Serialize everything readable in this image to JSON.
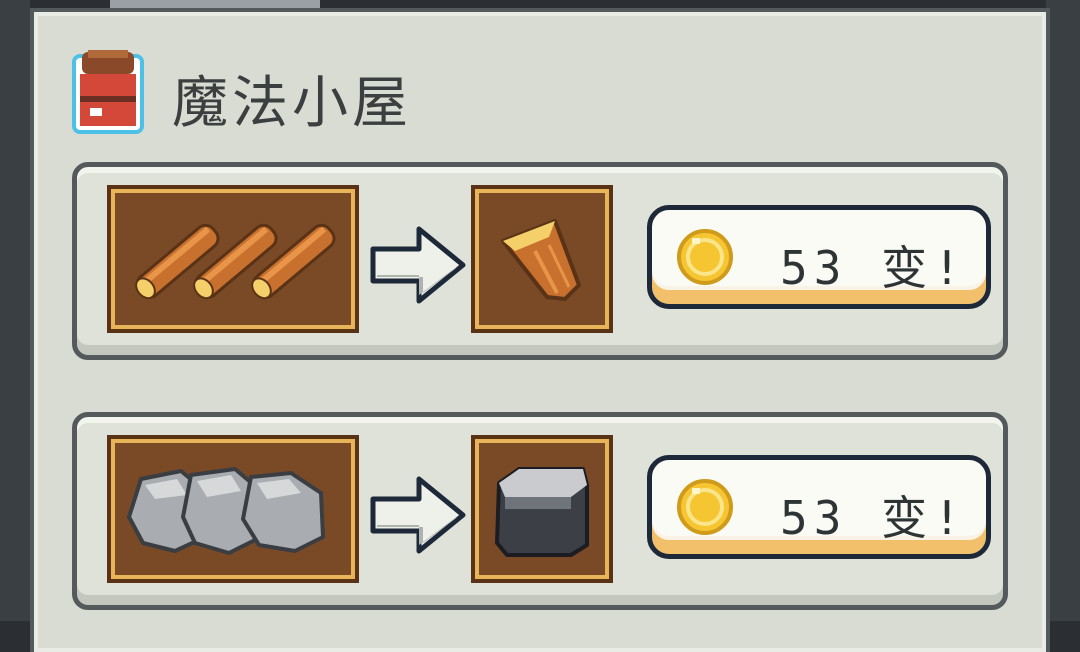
{
  "window": {
    "title": "魔法小屋",
    "icon": "magic-house-icon"
  },
  "recipes": [
    {
      "input_item": "log-icon",
      "input_count": 3,
      "output_item": "wood-plank-icon",
      "cost": "53",
      "action_label": "53 变!",
      "currency_icon": "gold-coin-icon"
    },
    {
      "input_item": "stone-icon",
      "input_count": 3,
      "output_item": "stone-block-icon",
      "cost": "53",
      "action_label": "53 变!",
      "currency_icon": "gold-coin-icon"
    }
  ],
  "colors": {
    "panel": "#d8dcd2",
    "slot": "#7a4a27",
    "slot_border": "#e8b45a",
    "button_border": "#1d2838",
    "coin": "#f5c532"
  }
}
